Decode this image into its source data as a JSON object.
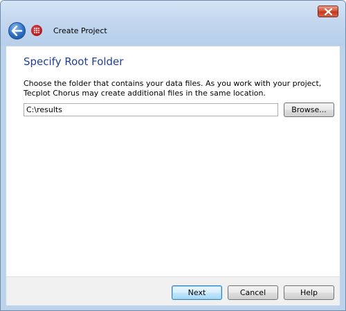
{
  "window": {
    "title": "Create Project"
  },
  "icons": {
    "close": "close-icon",
    "back": "back-arrow-icon",
    "app": "tecplot-app-icon"
  },
  "page": {
    "heading": "Specify Root Folder",
    "description": "Choose the folder that contains your data files. As you work with your project, Tecplot Chorus may create additional files in the same location.",
    "folder_path": "C:\\results",
    "browse_label": "Browse..."
  },
  "footer": {
    "next_label": "Next",
    "cancel_label": "Cancel",
    "help_label": "Help"
  },
  "colors": {
    "heading": "#1e3f9a",
    "window_frame": "#bdd3ec",
    "close_button": "#c3381c"
  }
}
